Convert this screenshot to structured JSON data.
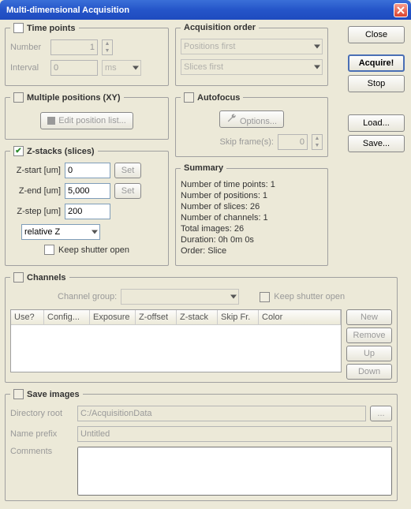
{
  "window": {
    "title": "Multi-dimensional Acquisition"
  },
  "sidebar": {
    "close": "Close",
    "acquire": "Acquire!",
    "stop": "Stop",
    "load": "Load...",
    "save": "Save..."
  },
  "timepoints": {
    "title": "Time points",
    "number_label": "Number",
    "number_value": "1",
    "interval_label": "Interval",
    "interval_value": "0",
    "unit": "ms"
  },
  "acq_order": {
    "title": "Acquisition order",
    "opt1": "Positions first",
    "opt2": "Slices first"
  },
  "positions": {
    "title": "Multiple positions (XY)",
    "edit_btn": "Edit position list..."
  },
  "autofocus": {
    "title": "Autofocus",
    "options_btn": "Options...",
    "skip_label": "Skip frame(s):",
    "skip_value": "0"
  },
  "zstacks": {
    "title": "Z-stacks (slices)",
    "zstart_label": "Z-start [um]",
    "zstart_value": "0",
    "zend_label": "Z-end [um]",
    "zend_value": "5,000",
    "zstep_label": "Z-step [um]",
    "zstep_value": "200",
    "set_btn": "Set",
    "mode": "relative Z",
    "keep_shutter": "Keep shutter open"
  },
  "summary": {
    "title": "Summary",
    "lines": {
      "l1": "Number of time points: 1",
      "l2": "Number of positions: 1",
      "l3": "Number of slices: 26",
      "l4": "Number of channels: 1",
      "l5": "Total images: 26",
      "l6": "Duration: 0h 0m 0s",
      "l7": "Order: Slice"
    }
  },
  "channels": {
    "title": "Channels",
    "group_label": "Channel group:",
    "keep_shutter": "Keep shutter open",
    "cols": {
      "c1": "Use?",
      "c2": "Config...",
      "c3": "Exposure",
      "c4": "Z-offset",
      "c5": "Z-stack",
      "c6": "Skip Fr.",
      "c7": "Color"
    },
    "new_btn": "New",
    "remove_btn": "Remove",
    "up_btn": "Up",
    "down_btn": "Down"
  },
  "save": {
    "title": "Save images",
    "dir_label": "Directory root",
    "dir_value": "C:/AcquisitionData",
    "browse_btn": "...",
    "prefix_label": "Name prefix",
    "prefix_value": "Untitled",
    "comments_label": "Comments"
  }
}
